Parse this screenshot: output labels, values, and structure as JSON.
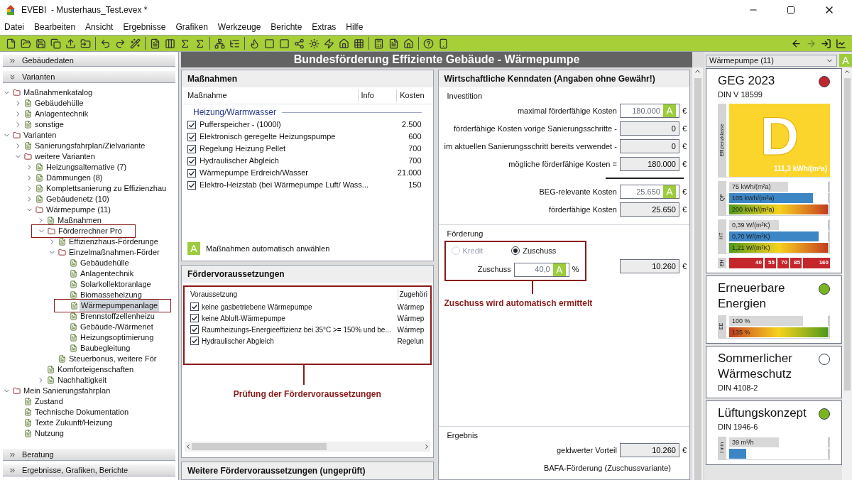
{
  "window": {
    "title": "EVEBI  - Musterhaus_Test.evex *"
  },
  "menu": [
    "Datei",
    "Bearbeiten",
    "Ansicht",
    "Ergebnisse",
    "Grafiken",
    "Werkzeuge",
    "Berichte",
    "Extras",
    "Hilfe"
  ],
  "left_panel": {
    "top_sections": [
      {
        "label": "Gebäudedaten",
        "expanded": false
      },
      {
        "label": "Varianten",
        "expanded": true
      }
    ],
    "tree": [
      {
        "label": "Maßnahmenkatalog",
        "expanded": true,
        "selected": false,
        "outlined": false,
        "children": [
          {
            "label": "Gebäudehülle",
            "expanded": false,
            "selected": false,
            "outlined": false
          },
          {
            "label": "Anlagentechnik",
            "expanded": false,
            "selected": false,
            "outlined": false
          },
          {
            "label": "sonstige",
            "expanded": false,
            "selected": false,
            "outlined": false
          }
        ]
      },
      {
        "label": "Varianten",
        "expanded": true,
        "selected": false,
        "outlined": false,
        "children": [
          {
            "label": "Sanierungsfahrplan/Zielvariante",
            "expanded": false,
            "selected": false,
            "outlined": false
          },
          {
            "label": "weitere Varianten",
            "expanded": true,
            "selected": false,
            "outlined": false,
            "children": [
              {
                "label": "Heizungsalternative (7)",
                "expanded": false,
                "selected": false,
                "outlined": false
              },
              {
                "label": "Dämmungen (8)",
                "expanded": false,
                "selected": false,
                "outlined": false
              },
              {
                "label": "Komplettsanierung zu Effizienzhau",
                "expanded": false,
                "selected": false,
                "outlined": false
              },
              {
                "label": "Gebäudenetz (10)",
                "expanded": false,
                "selected": false,
                "outlined": false
              },
              {
                "label": "Wärmepumpe (11)",
                "expanded": true,
                "selected": false,
                "outlined": false,
                "children": [
                  {
                    "label": "Maßnahmen",
                    "expanded": false,
                    "selected": false,
                    "outlined": false
                  },
                  {
                    "label": "Förderrechner Pro",
                    "expanded": true,
                    "selected": false,
                    "outlined": true,
                    "children": [
                      {
                        "label": "Effizienzhaus-Förderunge",
                        "expanded": false,
                        "selected": false,
                        "outlined": false
                      },
                      {
                        "label": "Einzelmaßnahmen-Förder",
                        "expanded": true,
                        "selected": false,
                        "outlined": false,
                        "children": [
                          {
                            "label": "Gebäudehülle",
                            "selected": false,
                            "outlined": false
                          },
                          {
                            "label": "Anlagentechnik",
                            "selected": false,
                            "outlined": false
                          },
                          {
                            "label": "Solarkollektoranlage",
                            "selected": false,
                            "outlined": false
                          },
                          {
                            "label": "Biomasseheizung",
                            "selected": false,
                            "outlined": false
                          },
                          {
                            "label": "Wärmepumpenanlage",
                            "selected": true,
                            "outlined": true
                          },
                          {
                            "label": "Brennstoffzellenheizu",
                            "selected": false,
                            "outlined": false
                          },
                          {
                            "label": "Gebäude-/Wärmenet",
                            "selected": false,
                            "outlined": false
                          },
                          {
                            "label": "Heizungsoptimierung",
                            "selected": false,
                            "outlined": false
                          },
                          {
                            "label": "Baubegleitung",
                            "selected": false,
                            "outlined": false
                          }
                        ]
                      },
                      {
                        "label": "Steuerbonus, weitere För",
                        "selected": false,
                        "outlined": false
                      }
                    ]
                  },
                  {
                    "label": "Komforteigenschaften",
                    "selected": false,
                    "outlined": false
                  },
                  {
                    "label": "Nachhaltigkeit",
                    "expanded": false,
                    "selected": false,
                    "outlined": false
                  }
                ]
              }
            ]
          }
        ]
      },
      {
        "label": "Mein Sanierungsfahrplan",
        "expanded": true,
        "selected": false,
        "outlined": false,
        "children": [
          {
            "label": "Zustand",
            "selected": false,
            "outlined": false
          },
          {
            "label": "Technische Dokumentation",
            "selected": false,
            "outlined": false
          },
          {
            "label": "Texte Zukunft/Heizung",
            "selected": false,
            "outlined": false
          },
          {
            "label": "Nutzung",
            "selected": false,
            "outlined": false
          }
        ]
      }
    ],
    "bottom_sections": [
      {
        "label": "Beratung",
        "expanded": false
      },
      {
        "label": "Ergebnisse, Grafiken, Berichte",
        "expanded": false
      }
    ]
  },
  "header": {
    "title": "Bundesförderung Effiziente Gebäude - Wärmepumpe"
  },
  "measures": {
    "title": "Maßnahmen",
    "columns": [
      "Maßnahme",
      "Info",
      "Kosten"
    ],
    "group": "Heizung/Warmwasser",
    "rows": [
      {
        "label": "Pufferspeicher - (1000l)",
        "cost": "2.500",
        "checked": true
      },
      {
        "label": "Elektronisch geregelte Heizungspumpe",
        "cost": "600",
        "checked": true
      },
      {
        "label": "Regelung Heizung Pellet",
        "cost": "700",
        "checked": true
      },
      {
        "label": "Hydraulischer Abgleich",
        "cost": "700",
        "checked": true
      },
      {
        "label": "Wärmepumpe Erdreich/Wasser",
        "cost": "21.000",
        "checked": true
      },
      {
        "label": "Elektro-Heizstab (bei Wärmepumpe Luft/ Wass...",
        "cost": "150",
        "checked": true
      }
    ],
    "auto_select": {
      "badge": "A",
      "label": "Maßnahmen automatisch anwählen"
    }
  },
  "requirements": {
    "title": "Fördervoraussetzungen",
    "columns": [
      "Voraussetzung",
      "Zugehöri"
    ],
    "rows": [
      {
        "label": "keine gasbetriebene Wärmepumpe",
        "group": "Wärmep",
        "checked": true
      },
      {
        "label": "keine Abluft-Wärmepumpe",
        "group": "Wärmep",
        "checked": true
      },
      {
        "label": "Raumheizungs-Energieeffizienz bei 35°C >= 150% und be...",
        "group": "Wärmep",
        "checked": true
      },
      {
        "label": "Hydraulischer Abgleich",
        "group": "Regelun",
        "checked": true
      }
    ],
    "annotation": "Prüfung der Fördervoraussetzungen"
  },
  "more_requirements": {
    "title": "Weitere Fördervoraussetzungen (ungeprüft)"
  },
  "economics": {
    "title": "Wirtschaftliche Kenndaten (Angaben ohne Gewähr!)",
    "investment": {
      "title": "Investition",
      "rows": [
        {
          "label": "maximal förderfähige Kosten",
          "value": "180.000",
          "badge": "A",
          "unit": "€",
          "kind": "input"
        },
        {
          "label": "förderfähige Kosten vorige Sanierungsschritte -",
          "value": "0",
          "unit": "€",
          "kind": "computed"
        },
        {
          "label": "im aktuellen Sanierungsschritt bereits verwendet -",
          "value": "0",
          "unit": "€",
          "kind": "computed"
        },
        {
          "label": "mögliche förderfähige Kosten =",
          "value": "180.000",
          "unit": "€",
          "kind": "computed"
        },
        {
          "kind": "rule"
        },
        {
          "label": "BEG-relevante Kosten",
          "value": "25.650",
          "badge": "A",
          "unit": "€",
          "kind": "input"
        },
        {
          "label": "förderfähige Kosten",
          "value": "25.650",
          "unit": "€",
          "kind": "computed"
        }
      ]
    },
    "funding": {
      "title": "Förderung",
      "options": [
        {
          "label": "Kredit",
          "selected": false,
          "disabled": true
        },
        {
          "label": "Zuschuss",
          "selected": true,
          "disabled": false
        }
      ],
      "rate": {
        "label": "Zuschuss",
        "value": "40,0",
        "badge": "A",
        "unit": "%"
      },
      "amount": {
        "value": "10.260",
        "unit": "€"
      },
      "annotation": "Zuschuss wird automatisch ermittelt"
    },
    "result": {
      "title": "Ergebnis",
      "rows": [
        {
          "label": "geldwerter Vorteil",
          "value": "10.260",
          "unit": "€"
        }
      ],
      "note": "BAFA-Förderung (Zuschussvariante)"
    }
  },
  "right_panel": {
    "variant_select": {
      "value": "Wärmepumpe (11)"
    },
    "auto_badge": "A",
    "cards": [
      {
        "title": "GEG 2023",
        "subtitle": "DIN V 18599",
        "color": "#c0262d",
        "class_label": "Effizienzklasse",
        "class": "D",
        "class_value": "111,3 kWh/(m²a)",
        "meters": [
          {
            "label": "QP",
            "bars": [
              {
                "text": "75 kWh/(m²a)",
                "kind": "current",
                "level": 0.6
              },
              {
                "text": "105 kWh/(m²a)",
                "kind": "limit",
                "level": 0.85
              },
              {
                "text": "200 kWh/(m²a)",
                "kind": "scale",
                "level": 1
              }
            ]
          },
          {
            "label": "HT",
            "bars": [
              {
                "text": "0,39 W/(m²K)",
                "kind": "current",
                "level": 0.5
              },
              {
                "text": "0,70 W/(m²K)",
                "kind": "limit",
                "level": 0.91
              },
              {
                "text": "1,21 W/(m²K)",
                "kind": "scale",
                "level": 1
              }
            ]
          }
        ],
        "steps_label": "EH",
        "steps": [
          "40",
          "55",
          "70",
          "85",
          "160"
        ]
      },
      {
        "title": "Erneuerbare Energien",
        "color": "#7ab51d",
        "meters": [
          {
            "label": "EE",
            "bars": [
              {
                "text": "100 %",
                "kind": "current",
                "level": 0.75
              },
              {
                "text": "135 %",
                "kind": "scale_reverse",
                "level": 1
              }
            ]
          }
        ]
      },
      {
        "title": "Sommerlicher Wärmeschutz",
        "subtitle": "DIN 4108-2",
        "color": "#ffffff"
      },
      {
        "title": "Lüftungskonzept",
        "subtitle": "DIN 1946-6",
        "color": "#7ab51d",
        "meters": [
          {
            "label": "l min",
            "bars": [
              {
                "text": "39 m³/h",
                "kind": "current",
                "level": 0.5
              },
              {
                "kind": "limit",
                "level": 0.17
              }
            ]
          }
        ]
      }
    ]
  }
}
